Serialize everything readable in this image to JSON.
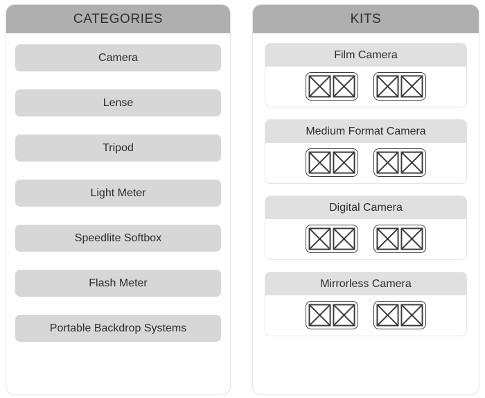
{
  "colors": {
    "panel_header_bg": "#afafaf",
    "panel_bg": "#ffffff",
    "panel_border": "#e3e3e3",
    "category_pill_bg": "#d7d7d7",
    "kit_header_bg": "#e0e0e0",
    "text": "#2c2c2c",
    "placeholder_stroke": "#3a3a3a"
  },
  "categories_panel": {
    "title": "CATEGORIES",
    "items": [
      {
        "label": "Camera"
      },
      {
        "label": "Lense"
      },
      {
        "label": "Tripod"
      },
      {
        "label": "Light Meter"
      },
      {
        "label": "Speedlite Softbox"
      },
      {
        "label": "Flash Meter"
      },
      {
        "label": "Portable Backdrop Systems"
      }
    ]
  },
  "kits_panel": {
    "title": "KITS",
    "items": [
      {
        "label": "Film Camera",
        "groups": 2,
        "thumbs_per_group": 2,
        "thumb_icon": "image-placeholder-icon"
      },
      {
        "label": "Medium Format Camera",
        "groups": 2,
        "thumbs_per_group": 2,
        "thumb_icon": "image-placeholder-icon"
      },
      {
        "label": "Digital Camera",
        "groups": 2,
        "thumbs_per_group": 2,
        "thumb_icon": "image-placeholder-icon"
      },
      {
        "label": "Mirrorless Camera",
        "groups": 2,
        "thumbs_per_group": 2,
        "thumb_icon": "image-placeholder-icon"
      }
    ]
  }
}
